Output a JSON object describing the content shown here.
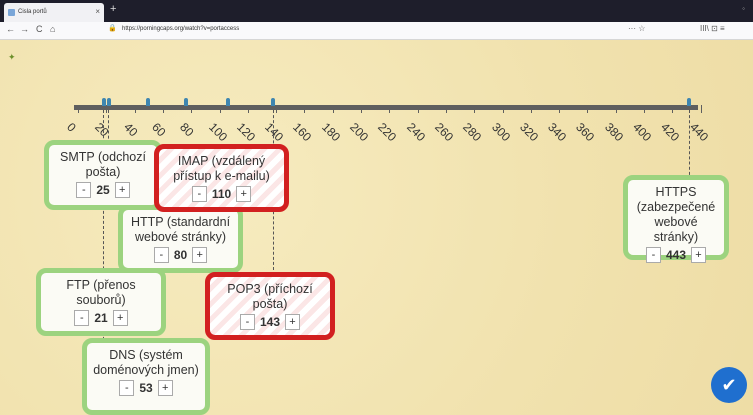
{
  "browser": {
    "tab_title": "Cisla portů",
    "tab_close": "×",
    "new_tab": "+",
    "url": "https://porningcaps.org/watch?v=portaccess",
    "nav": {
      "back": "←",
      "forward": "→",
      "reload": "C",
      "home": "⌂"
    },
    "url_icons": "···  ☆",
    "toolbar_icons": "III\\  ⊡  ≡"
  },
  "axis": {
    "ticks": [
      "0",
      "20",
      "40",
      "60",
      "80",
      "100",
      "120",
      "140",
      "160",
      "180",
      "200",
      "220",
      "240",
      "260",
      "280",
      "300",
      "320",
      "340",
      "360",
      "380",
      "400",
      "420",
      "440"
    ]
  },
  "cards": {
    "smtp": {
      "label": "SMTP (odchozí pošta)",
      "minus": "-",
      "value": "25",
      "plus": "+"
    },
    "imap": {
      "label": "IMAP (vzdálený přístup k e-mailu)",
      "minus": "-",
      "value": "110",
      "plus": "+"
    },
    "http": {
      "label": "HTTP (standardní webové stránky)",
      "minus": "-",
      "value": "80",
      "plus": "+"
    },
    "ftp": {
      "label": "FTP (přenos souborů)",
      "minus": "-",
      "value": "21",
      "plus": "+"
    },
    "pop3": {
      "label": "POP3 (příchozí pošta)",
      "minus": "-",
      "value": "143",
      "plus": "+"
    },
    "dns": {
      "label": "DNS (systém doménových jmen)",
      "minus": "-",
      "value": "53",
      "plus": "+"
    },
    "https": {
      "label": "HTTPS (zabezpečené webové stránky)",
      "minus": "-",
      "value": "443",
      "plus": "+"
    }
  },
  "colors": {
    "correct_border": "#9cd37f",
    "wrong_border": "#d22020",
    "axis": "#5f5f5f",
    "pin": "#3f86b0",
    "fab": "#1f6fcf"
  },
  "fab_icon": "check-circle-icon"
}
